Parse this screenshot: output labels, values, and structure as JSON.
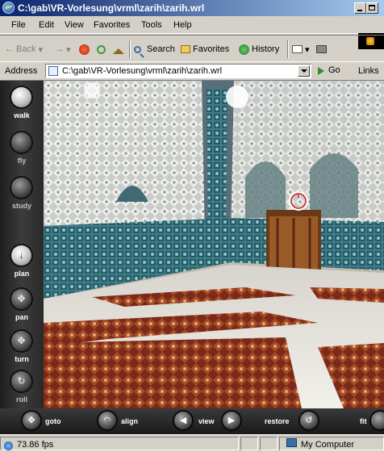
{
  "window": {
    "title": "C:\\gab\\VR-Vorlesung\\vrml\\zarih\\zarih.wrl"
  },
  "menu": [
    "File",
    "Edit",
    "View",
    "Favorites",
    "Tools",
    "Help"
  ],
  "toolbar": {
    "back": "Back",
    "search": "Search",
    "favorites": "Favorites",
    "history": "History"
  },
  "address": {
    "label": "Address",
    "value": "C:\\gab\\VR-Vorlesung\\vrml\\zarih\\zarih.wrl",
    "go": "Go",
    "links": "Links"
  },
  "viewer": {
    "nav_modes": [
      {
        "label": "walk",
        "active": true
      },
      {
        "label": "fly",
        "active": false
      },
      {
        "label": "study",
        "active": false
      },
      {
        "label": "plan",
        "active": false
      },
      {
        "label": "pan",
        "active": false
      },
      {
        "label": "turn",
        "active": false
      },
      {
        "label": "roll",
        "active": false
      }
    ],
    "bottom": {
      "goto": "goto",
      "align": "align",
      "view": "view",
      "restore": "restore",
      "fit": "fit"
    }
  },
  "status": {
    "fps": "73.86 fps",
    "zone": "My Computer"
  },
  "colors": {
    "title_start": "#0a246a",
    "title_end": "#a6caf0",
    "chrome": "#d4d0c8",
    "panel": "#2a2a2a"
  },
  "icons": [
    "ie-icon",
    "back-arrow-icon",
    "forward-arrow-icon",
    "stop-icon",
    "refresh-icon",
    "home-icon",
    "search-icon",
    "favorites-icon",
    "history-icon",
    "mail-icon",
    "print-icon",
    "page-icon",
    "go-arrow-icon",
    "computer-icon"
  ]
}
